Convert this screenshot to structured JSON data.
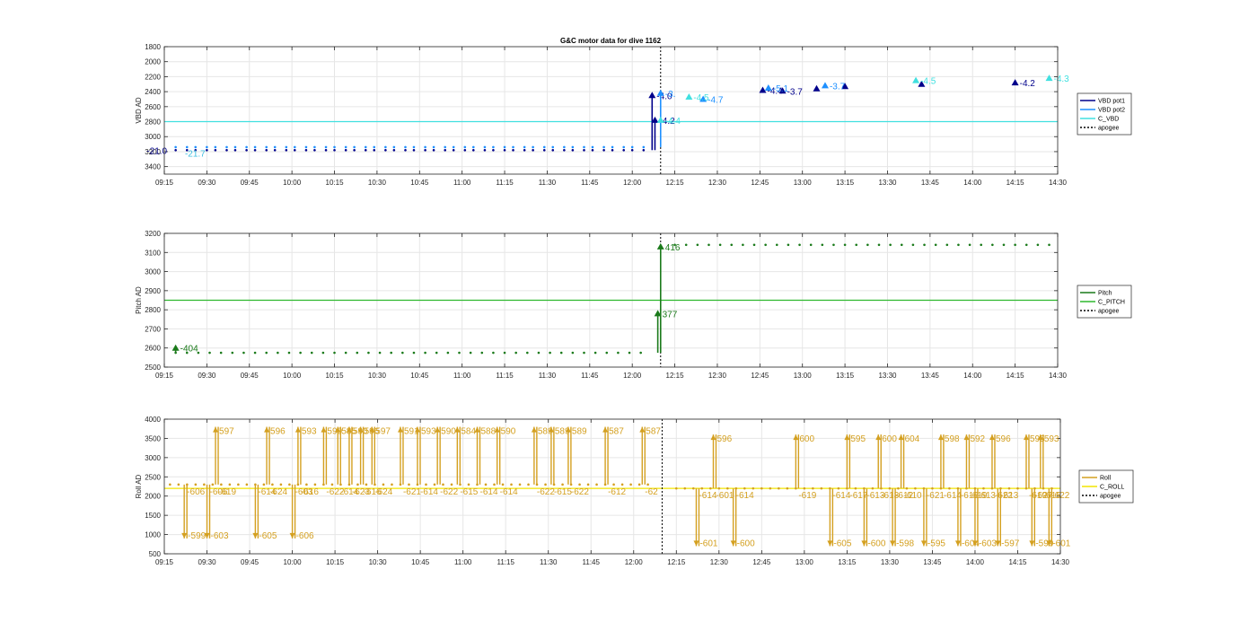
{
  "figure_title": "G&C motor data for dive 1162",
  "chart_data": [
    {
      "type": "line",
      "panel": "vbd",
      "ylabel": "VBD AD",
      "y_reversed": true,
      "ylim": [
        1800,
        3500
      ],
      "yticks": [
        1800,
        2000,
        2200,
        2400,
        2600,
        2800,
        3000,
        3200,
        3400
      ],
      "xlim": [
        "09:15",
        "14:30"
      ],
      "xticks": [
        "09:15",
        "09:30",
        "09:45",
        "10:00",
        "10:15",
        "10:30",
        "10:45",
        "11:00",
        "11:15",
        "11:30",
        "11:45",
        "12:00",
        "12:15",
        "12:30",
        "12:45",
        "13:00",
        "13:15",
        "13:30",
        "13:45",
        "14:00",
        "14:15",
        "14:30"
      ],
      "grid": true,
      "legend_position": "right",
      "apogee": "12:10",
      "legend": [
        {
          "name": "VBD pot1",
          "color": "#00008b",
          "style": "solid"
        },
        {
          "name": "VBD pot2",
          "color": "#1e90ff",
          "style": "solid"
        },
        {
          "name": "C_VBD",
          "color": "#40e0e0",
          "style": "solid"
        },
        {
          "name": "apogee",
          "color": "#000000",
          "style": "dotted"
        }
      ],
      "reference_line": {
        "name": "C_VBD",
        "value": 2800
      },
      "baseline_segments": [
        {
          "series": "VBD pot1",
          "from": "09:19",
          "to": "12:05",
          "value": 3180
        },
        {
          "series": "VBD pot2",
          "from": "09:19",
          "to": "12:05",
          "value": 3140
        }
      ],
      "baseline_spacing_min": 3.5,
      "series": [
        {
          "name": "VBD pot1",
          "color": "#00008b",
          "points": [
            {
              "x": "12:07",
              "y": 2450,
              "label": "-4.0"
            },
            {
              "x": "12:08",
              "y": 2780,
              "label": "-4.2"
            },
            {
              "x": "12:46",
              "y": 2380,
              "label": "-4.4"
            },
            {
              "x": "12:53",
              "y": 2390,
              "label": "-3.7"
            },
            {
              "x": "13:05",
              "y": 2360,
              "label": ""
            },
            {
              "x": "13:15",
              "y": 2330,
              "label": ""
            },
            {
              "x": "13:42",
              "y": 2300,
              "label": ""
            },
            {
              "x": "14:15",
              "y": 2280,
              "label": "-4.2"
            }
          ]
        },
        {
          "name": "VBD pot2",
          "color": "#1e90ff",
          "points": [
            {
              "x": "12:10",
              "y": 2420,
              "label": "-3."
            },
            {
              "x": "12:25",
              "y": 2500,
              "label": "-4.7"
            },
            {
              "x": "12:48",
              "y": 2350,
              "label": "-5.1"
            },
            {
              "x": "13:08",
              "y": 2320,
              "label": "-3.7"
            }
          ]
        },
        {
          "name": "C_VBD",
          "color": "#40e0e0",
          "points": [
            {
              "x": "12:10",
              "y": 2780,
              "label": "-4.4"
            },
            {
              "x": "12:20",
              "y": 2470,
              "label": "-4.5"
            },
            {
              "x": "13:40",
              "y": 2250,
              "label": "-4.5"
            },
            {
              "x": "14:27",
              "y": 2220,
              "label": "-4.3"
            }
          ]
        }
      ],
      "annotations": [
        {
          "text": "-21.0",
          "x": "09:17",
          "y": 3180
        },
        {
          "text": "-21.7",
          "x": "09:21",
          "y": 3220
        }
      ]
    },
    {
      "type": "line",
      "panel": "pitch",
      "ylabel": "Pitch AD",
      "ylim": [
        2500,
        3200
      ],
      "yticks": [
        2500,
        2600,
        2700,
        2800,
        2900,
        3000,
        3100,
        3200
      ],
      "xlim": [
        "09:15",
        "14:30"
      ],
      "xticks": [
        "09:15",
        "09:30",
        "09:45",
        "10:00",
        "10:15",
        "10:30",
        "10:45",
        "11:00",
        "11:15",
        "11:30",
        "11:45",
        "12:00",
        "12:15",
        "12:30",
        "12:45",
        "13:00",
        "13:15",
        "13:30",
        "13:45",
        "14:00",
        "14:15",
        "14:30"
      ],
      "grid": true,
      "legend_position": "right",
      "apogee": "12:10",
      "legend": [
        {
          "name": "Pitch",
          "color": "#1a7a1a",
          "style": "solid"
        },
        {
          "name": "C_PITCH",
          "color": "#2eb82e",
          "style": "solid"
        },
        {
          "name": "apogee",
          "color": "#000000",
          "style": "dotted"
        }
      ],
      "reference_line": {
        "name": "C_PITCH",
        "value": 2850
      },
      "baseline_segments": [
        {
          "series": "Pitch",
          "from": "09:19",
          "to": "12:05",
          "value": 2575
        },
        {
          "series": "Pitch",
          "from": "12:15",
          "to": "14:28",
          "value": 3140
        }
      ],
      "baseline_spacing_min": 4,
      "series": [
        {
          "name": "Pitch",
          "color": "#1a7a1a",
          "points": [
            {
              "x": "09:19",
              "y": 2600,
              "label": "-404"
            },
            {
              "x": "12:09",
              "y": 2780,
              "label": "377"
            },
            {
              "x": "12:10",
              "y": 3130,
              "label": "416"
            }
          ]
        }
      ]
    },
    {
      "type": "line",
      "panel": "roll",
      "ylabel": "Roll AD",
      "ylim": [
        500,
        4000
      ],
      "yticks": [
        500,
        1000,
        1500,
        2000,
        2500,
        3000,
        3500,
        4000
      ],
      "xlim": [
        "09:15",
        "14:30"
      ],
      "xticks": [
        "09:15",
        "09:30",
        "09:45",
        "10:00",
        "10:15",
        "10:30",
        "10:45",
        "11:00",
        "11:15",
        "11:30",
        "11:45",
        "12:00",
        "12:15",
        "12:30",
        "12:45",
        "13:00",
        "13:15",
        "13:30",
        "13:45",
        "14:00",
        "14:15",
        "14:30"
      ],
      "grid": true,
      "legend_position": "right",
      "apogee": "12:10",
      "legend": [
        {
          "name": "Roll",
          "color": "#d4a020",
          "style": "solid"
        },
        {
          "name": "C_ROLL",
          "color": "#f2e600",
          "style": "solid"
        },
        {
          "name": "apogee",
          "color": "#000000",
          "style": "dotted"
        }
      ],
      "reference_line": {
        "name": "C_ROLL",
        "value": 2200
      },
      "baseline_segments": [
        {
          "series": "Roll",
          "from": "09:17",
          "to": "12:05",
          "value": 2300
        },
        {
          "series": "Roll",
          "from": "12:15",
          "to": "14:28",
          "value": 2200
        }
      ],
      "baseline_spacing_min": 3,
      "events": [
        {
          "x": "09:22",
          "peak": 900,
          "label": "-599",
          "return_label": "-606"
        },
        {
          "x": "09:30",
          "peak": 900,
          "label": "-603",
          "return_label": "-606"
        },
        {
          "x": "09:33",
          "peak": 3800,
          "label": "597",
          "return_label": "-619"
        },
        {
          "x": "09:47",
          "peak": 900,
          "label": "-605",
          "return_label": "-614"
        },
        {
          "x": "09:51",
          "peak": 3800,
          "label": "596",
          "return_label": "-624"
        },
        {
          "x": "10:00",
          "peak": 900,
          "label": "-606",
          "return_label": "-603"
        },
        {
          "x": "10:02",
          "peak": 3800,
          "label": "593",
          "return_label": "-616"
        },
        {
          "x": "10:11",
          "peak": 3800,
          "label": "590",
          "return_label": "-622"
        },
        {
          "x": "10:16",
          "peak": 3800,
          "label": "585",
          "return_label": "-614"
        },
        {
          "x": "10:20",
          "peak": 3800,
          "label": "590",
          "return_label": "-623"
        },
        {
          "x": "10:24",
          "peak": 3800,
          "label": "596",
          "return_label": "-616"
        },
        {
          "x": "10:28",
          "peak": 3800,
          "label": "597",
          "return_label": "-624"
        },
        {
          "x": "10:38",
          "peak": 3800,
          "label": "591",
          "return_label": "-621"
        },
        {
          "x": "10:44",
          "peak": 3800,
          "label": "593",
          "return_label": "-614"
        },
        {
          "x": "10:51",
          "peak": 3800,
          "label": "590",
          "return_label": "-622"
        },
        {
          "x": "10:58",
          "peak": 3800,
          "label": "584",
          "return_label": "-615"
        },
        {
          "x": "11:05",
          "peak": 3800,
          "label": "588",
          "return_label": "-614"
        },
        {
          "x": "11:12",
          "peak": 3800,
          "label": "590",
          "return_label": "-614"
        },
        {
          "x": "11:25",
          "peak": 3800,
          "label": "589",
          "return_label": "-622"
        },
        {
          "x": "11:31",
          "peak": 3800,
          "label": "589",
          "return_label": "-615"
        },
        {
          "x": "11:37",
          "peak": 3800,
          "label": "589",
          "return_label": "-622"
        },
        {
          "x": "11:50",
          "peak": 3800,
          "label": "587",
          "return_label": "-612"
        },
        {
          "x": "12:03",
          "peak": 3800,
          "label": "587",
          "return_label": "-62"
        },
        {
          "x": "12:22",
          "peak": 700,
          "label": "-601",
          "return_label": "-614"
        },
        {
          "x": "12:28",
          "peak": 3600,
          "label": "596",
          "return_label": "-601"
        },
        {
          "x": "12:35",
          "peak": 700,
          "label": "-600",
          "return_label": "-614"
        },
        {
          "x": "12:57",
          "peak": 3600,
          "label": "600",
          "return_label": "-619"
        },
        {
          "x": "13:09",
          "peak": 700,
          "label": "-605",
          "return_label": "-614"
        },
        {
          "x": "13:15",
          "peak": 3600,
          "label": "595",
          "return_label": "-617"
        },
        {
          "x": "13:21",
          "peak": 700,
          "label": "-600",
          "return_label": "-613"
        },
        {
          "x": "13:26",
          "peak": 3600,
          "label": "600",
          "return_label": "-613"
        },
        {
          "x": "13:31",
          "peak": 700,
          "label": "-598",
          "return_label": "-612"
        },
        {
          "x": "13:34",
          "peak": 3600,
          "label": "604",
          "return_label": "-610"
        },
        {
          "x": "13:42",
          "peak": 700,
          "label": "-595",
          "return_label": "-621"
        },
        {
          "x": "13:48",
          "peak": 3600,
          "label": "598",
          "return_label": "-614"
        },
        {
          "x": "13:54",
          "peak": 700,
          "label": "-604",
          "return_label": "-616"
        },
        {
          "x": "13:57",
          "peak": 3600,
          "label": "592",
          "return_label": "-619"
        },
        {
          "x": "14:00",
          "peak": 700,
          "label": "-603",
          "return_label": "-613"
        },
        {
          "x": "14:06",
          "peak": 3600,
          "label": "596",
          "return_label": "-622"
        },
        {
          "x": "14:08",
          "peak": 700,
          "label": "-597",
          "return_label": "-613"
        },
        {
          "x": "14:18",
          "peak": 3600,
          "label": "595",
          "return_label": "-619"
        },
        {
          "x": "14:20",
          "peak": 700,
          "label": "-599",
          "return_label": "-627"
        },
        {
          "x": "14:23",
          "peak": 3600,
          "label": "593",
          "return_label": "-615"
        },
        {
          "x": "14:26",
          "peak": 700,
          "label": "-601",
          "return_label": "-622"
        }
      ]
    }
  ]
}
